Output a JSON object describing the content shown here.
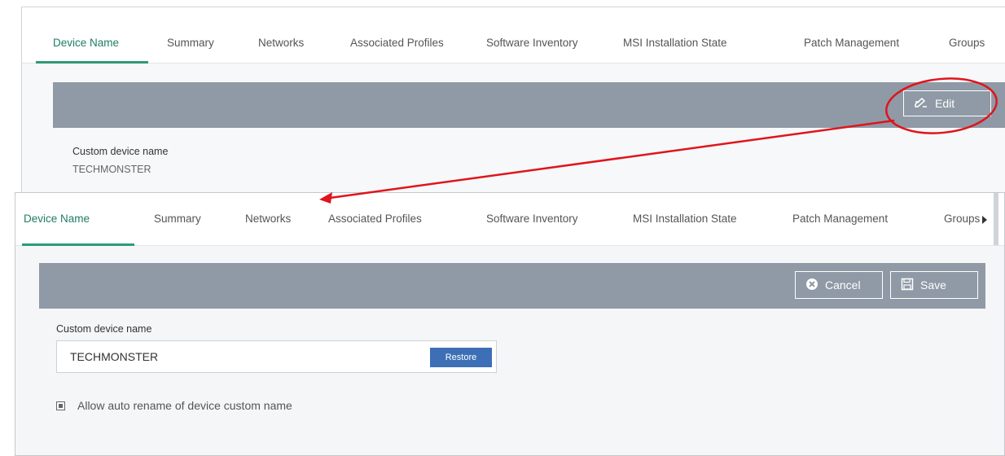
{
  "top_view": {
    "tabs": [
      {
        "label": "Device Name",
        "active": true
      },
      {
        "label": "Summary"
      },
      {
        "label": "Networks"
      },
      {
        "label": "Associated Profiles"
      },
      {
        "label": "Software Inventory"
      },
      {
        "label": "MSI Installation State"
      },
      {
        "label": "Patch Management"
      },
      {
        "label": "Groups"
      }
    ],
    "toolbar": {
      "edit_label": "Edit"
    },
    "custom_device_name_label": "Custom device name",
    "custom_device_name_value": "TECHMONSTER"
  },
  "bottom_view": {
    "tabs": [
      {
        "label": "Device Name",
        "active": true
      },
      {
        "label": "Summary"
      },
      {
        "label": "Networks"
      },
      {
        "label": "Associated Profiles"
      },
      {
        "label": "Software Inventory"
      },
      {
        "label": "MSI Installation State"
      },
      {
        "label": "Patch Management"
      },
      {
        "label": "Groups"
      }
    ],
    "toolbar": {
      "cancel_label": "Cancel",
      "save_label": "Save"
    },
    "form": {
      "custom_device_name_label": "Custom device name",
      "input_value": "TECHMONSTER",
      "restore_label": "Restore",
      "checkbox_label": "Allow auto rename of device custom name",
      "checkbox_checked": true
    }
  },
  "colors": {
    "accent": "#2e9a78",
    "toolbar": "#8f9aa6",
    "primary_button": "#3d6fb6",
    "annotation": "#e0141b"
  },
  "icons": {
    "edit": "edit-pencil-icon",
    "cancel": "cancel-circle-icon",
    "save": "save-disk-icon",
    "tab_next": "chevron-right-icon"
  }
}
